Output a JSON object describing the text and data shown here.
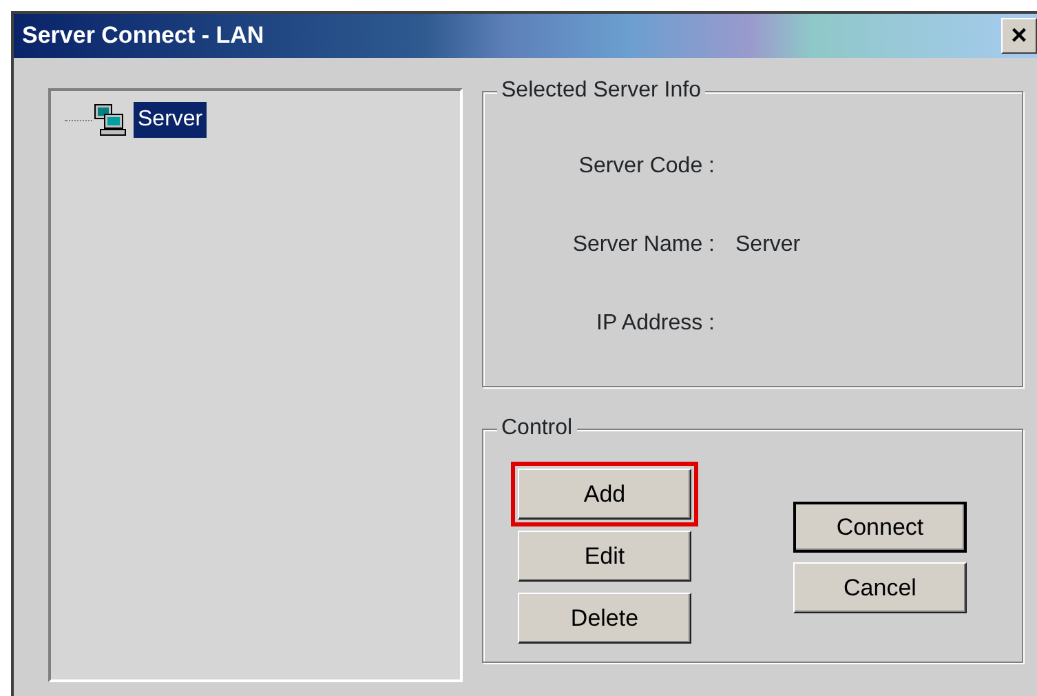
{
  "window": {
    "title": "Server Connect - LAN",
    "close": "×"
  },
  "tree": {
    "items": [
      {
        "label": "Server",
        "selected": true
      }
    ]
  },
  "info_group": {
    "title": "Selected Server Info",
    "fields": [
      {
        "label": "Server Code :"
      },
      {
        "label": "Server Name :",
        "value": "Server"
      },
      {
        "label": "IP Address :"
      }
    ]
  },
  "control_group": {
    "title": "Control",
    "left_buttons": [
      {
        "label": "Add",
        "highlighted": true
      },
      {
        "label": "Edit",
        "highlighted": false
      },
      {
        "label": "Delete",
        "highlighted": false
      }
    ],
    "right_buttons": [
      {
        "label": "Connect",
        "default": true
      },
      {
        "label": "Cancel",
        "default": false
      }
    ]
  }
}
